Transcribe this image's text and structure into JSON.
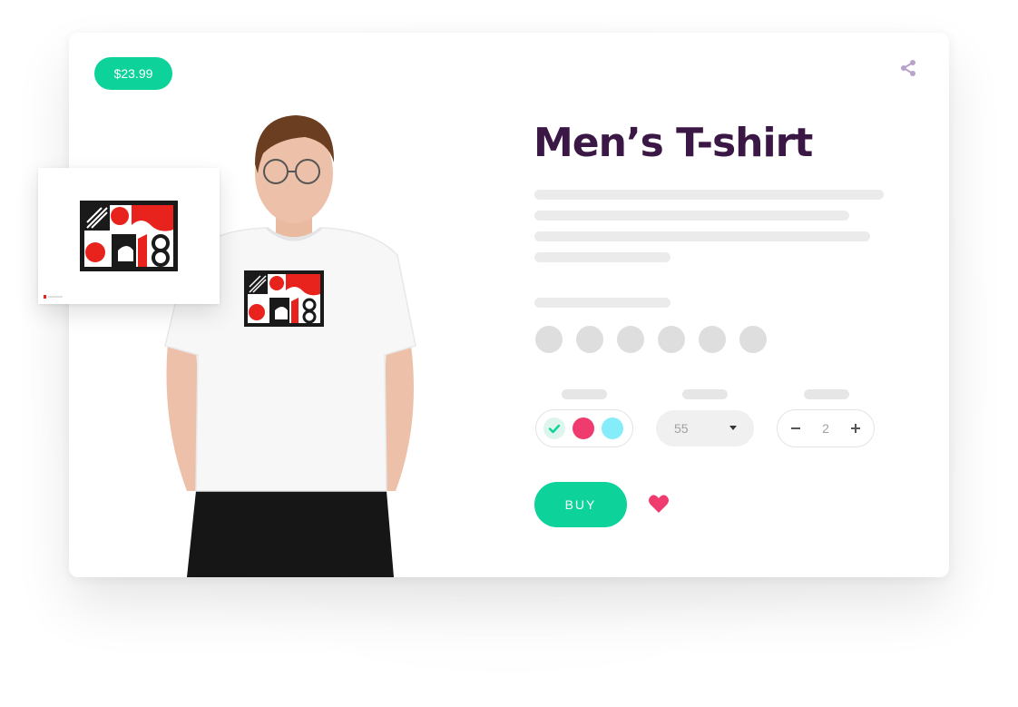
{
  "product": {
    "price": "$23.99",
    "title": "Men’s T-shirt"
  },
  "options": {
    "colors": [
      {
        "name": "mint",
        "hex": "#ddf5ec",
        "selected": true
      },
      {
        "name": "pink",
        "hex": "#ef3b6e",
        "selected": false
      },
      {
        "name": "cyan",
        "hex": "#85ecfa",
        "selected": false
      }
    ],
    "size": "55",
    "quantity": "2"
  },
  "actions": {
    "buy_label": "BUY"
  },
  "icons": {
    "share": "share-icon",
    "heart": "heart-icon",
    "check": "check-icon",
    "minus": "minus-icon",
    "plus": "plus-icon",
    "caret": "chevron-down-icon"
  },
  "colors": {
    "accent": "#0dd39a",
    "title": "#3a1745",
    "heart": "#ef3b6e",
    "placeholder": "#ebebeb",
    "artwork_red": "#e8231d",
    "artwork_black": "#1a1a1a"
  }
}
